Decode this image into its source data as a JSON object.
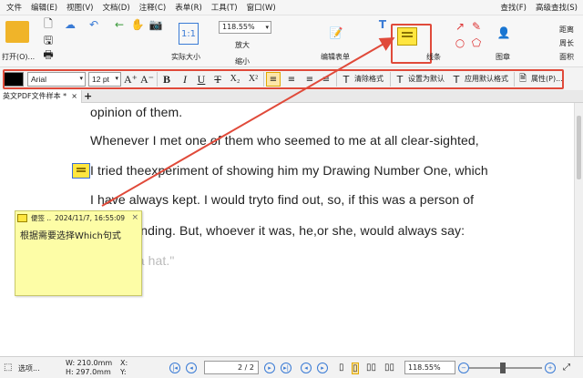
{
  "menu": {
    "items": [
      "文件",
      "编辑(E)",
      "视图(V)",
      "文档(D)",
      "注释(C)",
      "表单(R)",
      "工具(T)",
      "窗口(W)"
    ],
    "right": [
      "查找(F)",
      "高级查找(S)"
    ]
  },
  "ribbon": {
    "open_label": "打开(O)...",
    "zoom_value": "118.55%",
    "actual_size": "实际大小",
    "zoom_in": "放大",
    "zoom_out": "缩小",
    "edit_form": "编辑表单",
    "lines": "线条",
    "stamp": "图章",
    "distance": "距离",
    "perimeter": "周长",
    "area": "面积"
  },
  "format_bar": {
    "font_color": "#000000",
    "font_name": "Arial",
    "font_size": "12 pt",
    "grow": "A⁺",
    "shrink": "A⁻",
    "bold": "B",
    "italic": "I",
    "underline": "U",
    "strike": "T",
    "subscript": "X₂",
    "superscript": "X²",
    "clear_format": "清除格式",
    "set_default": "设置为默认",
    "apply_default": "应用默认格式",
    "properties": "属性(P)..."
  },
  "tab": {
    "title": "英文PDF文件样本 *",
    "close": "×",
    "add": "+"
  },
  "document": {
    "lines": [
      "opinion of them.",
      "Whenever I met one of them who seemed to me at all clear-sighted,",
      "I tried theexperiment of showing him my Drawing Number One, which",
      "I have always kept. I would tryto find out, so,     if this was a person of",
      "understanding. But, whoever it was,     he,or she, would always say:",
      "\"That is a hat.\""
    ]
  },
  "note": {
    "author": "便签 ..",
    "date": "2024/11/7, 16:55:09",
    "close": "×",
    "text": "根据需要选择Which句式"
  },
  "status": {
    "select": "选项...",
    "width": "W: 210.0mm",
    "height": "H: 297.0mm",
    "x": "X:",
    "y": "Y:",
    "page": "2 / 2",
    "zoom": "118.55%"
  },
  "colors": {
    "highlight": "#e04a3a",
    "note": "#ffe640",
    "note_popup": "#fdfda6"
  }
}
